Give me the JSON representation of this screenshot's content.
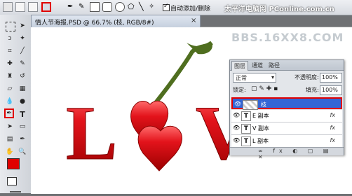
{
  "options_bar": {
    "auto_select_label": "自动添加/删除",
    "watermark_top": "太平洋电脑网 PConline.com.cn"
  },
  "document": {
    "tab_title": "情人节海报.PSD @ 66.7% (枝, RGB/8#)",
    "close": "×"
  },
  "watermark": {
    "text": "BBS.16XX8.COM"
  },
  "layers_panel": {
    "tabs": [
      "图层",
      "通道",
      "路径"
    ],
    "blend_mode": "正常",
    "opacity_label": "不透明度:",
    "opacity_value": "100%",
    "lock_label": "锁定:",
    "fill_label": "填充:",
    "fill_value": "100%",
    "layers": [
      {
        "name": "枝",
        "active": true
      },
      {
        "name": "E 副本",
        "active": false
      },
      {
        "name": "V 副本",
        "active": false
      },
      {
        "name": "L 副本",
        "active": false
      }
    ],
    "fx_label": "fx"
  },
  "colors": {
    "foreground": "#e00000",
    "letters": "#d9181f",
    "heart": "#e3131b",
    "stem": "#4f6e1f"
  }
}
